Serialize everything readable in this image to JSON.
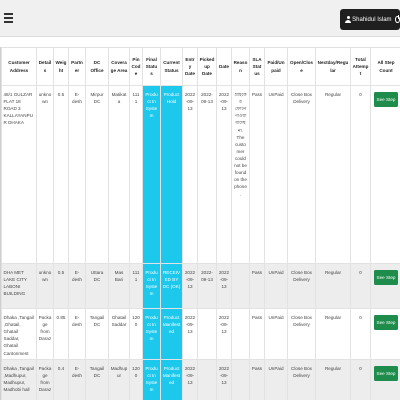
{
  "header": {
    "user_name": "Shahidul Islam",
    "icons": [
      "menu-icon",
      "user-icon",
      "power-icon"
    ]
  },
  "table": {
    "columns": [
      "Customer Address",
      "Details",
      "Weight",
      "Partner",
      "DC Office",
      "Coverage Area",
      "Pin Code",
      "Final Status",
      "Current Status",
      "Entry Date",
      "Pickedup Date",
      "Date",
      "Reason",
      "SLA Status",
      "Paid/Unpaid",
      "Open/Close",
      "Nextday/Regular",
      "Total Attempt",
      "All Step Count"
    ],
    "rows": [
      {
        "address": "48/1 GULZAR FLAT 18 ROAD 3 KALLAYANPUR DHAKA",
        "details": "unknown",
        "weight": "0.5",
        "partner": "E-desh",
        "dc_office": "Mirpur DC",
        "coverage": "Matikata",
        "pin": "1111",
        "final_status": "Product In System",
        "current_status": "Product Hold",
        "entry_date": "2022-09-13",
        "pickedup_date": "2022-09-13",
        "date": "2022-09-13",
        "reason": "গ্রাহকের ফোনে পাওয়া যাচ্ছে না. The customer could not be found on the phone.",
        "sla": "Pass",
        "paid": "UnPaid",
        "open_close": "Close Box Delivery",
        "nextday": "Regular",
        "attempt": "0",
        "action": "See Step"
      },
      {
        "address": "DHA MET LAKE CITY LABONI BUILDING",
        "details": "unknown",
        "weight": "0.5",
        "partner": "E-desh",
        "dc_office": "Uttara DC",
        "coverage": "Mas Bari",
        "pin": "1111",
        "final_status": "Product In System",
        "current_status": "RECEIVED BY DC (OK)",
        "entry_date": "2022-09-13",
        "pickedup_date": "2022-09-13",
        "date": "2022-09-13",
        "reason": "",
        "sla": "Pass",
        "paid": "UnPaid",
        "open_close": "Close Box Delivery",
        "nextday": "Regular",
        "attempt": "0",
        "action": "See Step"
      },
      {
        "address": "Dhaka ,Tangail ,Ghatail, Ghatail Saddar, Ghatail Cantonment",
        "details": "Package from Daraz",
        "weight": "0.85",
        "partner": "E-desh",
        "dc_office": "Tangail DC",
        "coverage": "Ghatail Saddar",
        "pin": "1200",
        "final_status": "Product In System",
        "current_status": "Product Manifested",
        "entry_date": "2022-09-13",
        "pickedup_date": "",
        "date": "2022-09-13",
        "reason": "",
        "sla": "Pass",
        "paid": "UnPaid",
        "open_close": "Close Box Delivery",
        "nextday": "Regular",
        "attempt": "0",
        "action": "See Step"
      },
      {
        "address": "Dhaka ,Tangail ,Madhupur, Madhupur, Madhobi hall",
        "details": "Package from Daraz",
        "weight": "0.4",
        "partner": "E-desh",
        "dc_office": "Tangail DC",
        "coverage": "Madhupur",
        "pin": "1200",
        "final_status": "Product In System",
        "current_status": "Product Manifested",
        "entry_date": "2022-09-13",
        "pickedup_date": "",
        "date": "2022-09-13",
        "reason": "",
        "sla": "Pass",
        "paid": "UnPaid",
        "open_close": "Close Box Delivery",
        "nextday": "Regular",
        "attempt": "0",
        "action": "See Step"
      }
    ]
  },
  "colors": {
    "status_cyan": "#1cc8ec",
    "button_green": "#1e8c4a",
    "user_button": "#1f1f1f"
  }
}
